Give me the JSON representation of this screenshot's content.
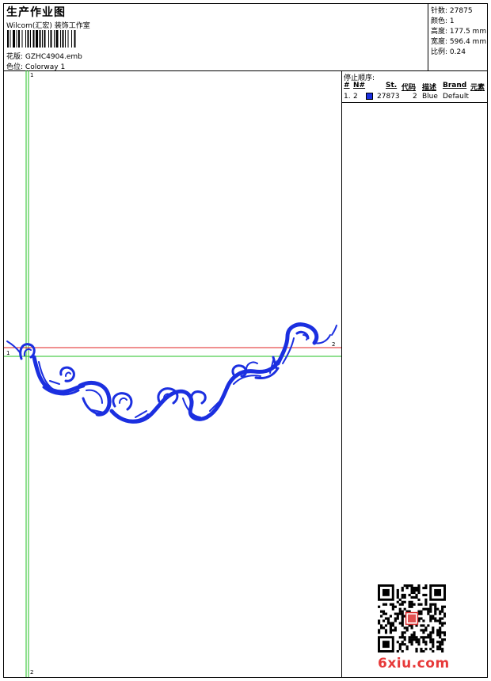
{
  "header": {
    "title": "生产作业图",
    "subtitle": "Wilcom(汇宏) 装饰工作室",
    "design_label": "花版:",
    "design_name": "GZHC4904.emb",
    "colorway_label": "色位:",
    "colorway_name": "Colorway 1"
  },
  "stats": [
    {
      "label": "针数:",
      "value": "27875"
    },
    {
      "label": "颜色:",
      "value": "1"
    },
    {
      "label": "高度:",
      "value": "177.5 mm"
    },
    {
      "label": "宽度:",
      "value": "596.4 mm"
    },
    {
      "label": "比例:",
      "value": "0.24"
    }
  ],
  "stop_sequence": {
    "title": "停止顺序:",
    "columns": [
      "#",
      "N#",
      "St.",
      "代码",
      "描述",
      "Brand",
      "元素"
    ],
    "rows": [
      {
        "index": "1.",
        "needle": "2",
        "stitches": "27873",
        "code": "2",
        "description": "Blue",
        "brand": "Default",
        "color": "#1b2fe0"
      }
    ]
  },
  "axis_markers": {
    "left": "1",
    "right": "2",
    "top": "1",
    "bottom": "2"
  },
  "watermark": "6xiu.com",
  "colors": {
    "thread": "#1b2fe0",
    "guide_red": "#e02020",
    "guide_green": "#22c022",
    "watermark": "#e73a3a"
  }
}
